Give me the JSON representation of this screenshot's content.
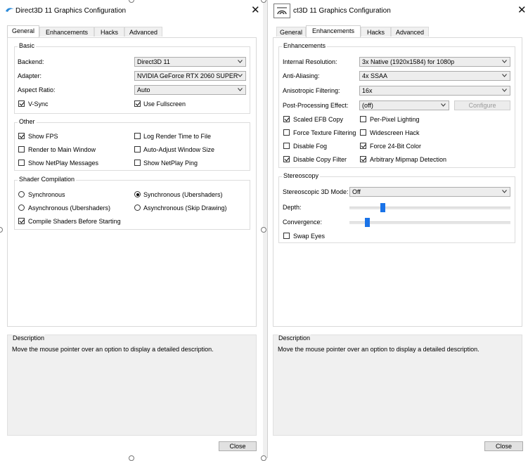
{
  "left_window": {
    "title": "Direct3D 11 Graphics Configuration",
    "tabs": [
      {
        "label": "General",
        "active": true
      },
      {
        "label": "Enhancements",
        "active": false
      },
      {
        "label": "Hacks",
        "active": false
      },
      {
        "label": "Advanced",
        "active": false
      }
    ],
    "basic": {
      "title": "Basic",
      "backend_label": "Backend:",
      "backend_value": "Direct3D 11",
      "adapter_label": "Adapter:",
      "adapter_value": "NVIDIA GeForce RTX 2060 SUPER",
      "aspect_label": "Aspect Ratio:",
      "aspect_value": "Auto",
      "vsync": {
        "label": "V-Sync",
        "checked": true
      },
      "fullscreen": {
        "label": "Use Fullscreen",
        "checked": true
      }
    },
    "other": {
      "title": "Other",
      "items": [
        {
          "label": "Show FPS",
          "checked": true
        },
        {
          "label": "Log Render Time to File",
          "checked": false
        },
        {
          "label": "Render to Main Window",
          "checked": false
        },
        {
          "label": "Auto-Adjust Window Size",
          "checked": false
        },
        {
          "label": "Show NetPlay Messages",
          "checked": false
        },
        {
          "label": "Show NetPlay Ping",
          "checked": false
        }
      ]
    },
    "shader": {
      "title": "Shader Compilation",
      "radios": [
        {
          "label": "Synchronous",
          "checked": false
        },
        {
          "label": "Synchronous (Ubershaders)",
          "checked": true
        },
        {
          "label": "Asynchronous (Ubershaders)",
          "checked": false
        },
        {
          "label": "Asynchronous (Skip Drawing)",
          "checked": false
        }
      ],
      "compile_before": {
        "label": "Compile Shaders Before Starting",
        "checked": true
      }
    },
    "description": {
      "title": "Description",
      "text": "Move the mouse pointer over an option to display a detailed description."
    },
    "close_label": "Close"
  },
  "right_window": {
    "title": "ct3D 11 Graphics Configuration",
    "tabs": [
      {
        "label": "General",
        "active": false
      },
      {
        "label": "Enhancements",
        "active": true
      },
      {
        "label": "Hacks",
        "active": false
      },
      {
        "label": "Advanced",
        "active": false
      }
    ],
    "enhancements": {
      "title": "Enhancements",
      "internal_res_label": "Internal Resolution:",
      "internal_res_value": "3x Native (1920x1584) for 1080p",
      "aa_label": "Anti-Aliasing:",
      "aa_value": "4x SSAA",
      "aniso_label": "Anisotropic Filtering:",
      "aniso_value": "16x",
      "post_label": "Post-Processing Effect:",
      "post_value": "(off)",
      "configure_label": "Configure",
      "checks": [
        {
          "label": "Scaled EFB Copy",
          "checked": true
        },
        {
          "label": "Per-Pixel Lighting",
          "checked": false
        },
        {
          "label": "Force Texture Filtering",
          "checked": false
        },
        {
          "label": "Widescreen Hack",
          "checked": false
        },
        {
          "label": "Disable Fog",
          "checked": false
        },
        {
          "label": "Force 24-Bit Color",
          "checked": true
        },
        {
          "label": "Disable Copy Filter",
          "checked": true
        },
        {
          "label": "Arbitrary Mipmap Detection",
          "checked": true
        }
      ]
    },
    "stereoscopy": {
      "title": "Stereoscopy",
      "mode_label": "Stereoscopic 3D Mode:",
      "mode_value": "Off",
      "depth_label": "Depth:",
      "depth_level": 0.2,
      "convergence_label": "Convergence:",
      "convergence_level": 0.1,
      "swap_eyes": {
        "label": "Swap Eyes",
        "checked": false
      }
    },
    "description": {
      "title": "Description",
      "text": "Move the mouse pointer over an option to display a detailed description."
    },
    "close_label": "Close"
  },
  "colors": {
    "accent": "#1a73e8",
    "panel_bg": "#f0f0f0"
  }
}
